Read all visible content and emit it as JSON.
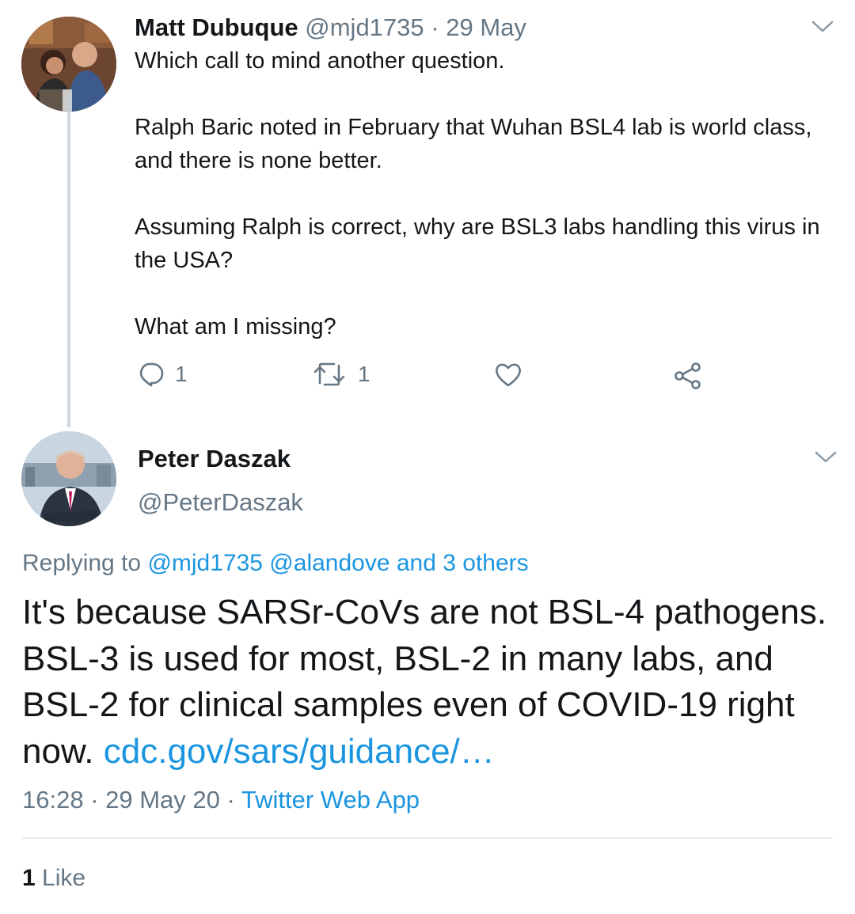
{
  "tweet1": {
    "author_name": "Matt Dubuque",
    "handle": "@mjd1735",
    "separator": " · ",
    "date": "29 May",
    "paragraphs": [
      "Which call to mind another question.",
      "Ralph Baric noted in February that Wuhan BSL4 lab is world class, and there is none better.",
      "Assuming Ralph is correct, why are BSL3 labs handling this virus in the USA?",
      "What am I missing?"
    ],
    "reply_count": "1",
    "retweet_count": "1"
  },
  "tweet2": {
    "author_name": "Peter Daszak",
    "handle": "@PeterDaszak",
    "replying_prefix": "Replying to ",
    "replying_targets": "@mjd1735 @alandove and 3 others",
    "body_text": "It's because SARSr-CoVs are not BSL-4 pathogens. BSL-3 is used for most, BSL-2 in many labs, and BSL-2 for clinical samples even of COVID-19 right now. ",
    "body_link": "cdc.gov/sars/guidance/…",
    "time": "16:28",
    "separator": " · ",
    "date": "29 May 20",
    "source_sep": " · ",
    "source": "Twitter Web App",
    "likes_count": "1",
    "likes_label": "Like"
  },
  "icons": {
    "reply": "reply-icon",
    "retweet": "retweet-icon",
    "like": "heart-icon",
    "share": "share-icon",
    "more": "chevron-down-icon"
  },
  "colors": {
    "text": "#14171a",
    "secondary": "#657786",
    "link": "#1b95e0",
    "thread_line": "#cfd9de",
    "divider": "#e6ecf0"
  }
}
